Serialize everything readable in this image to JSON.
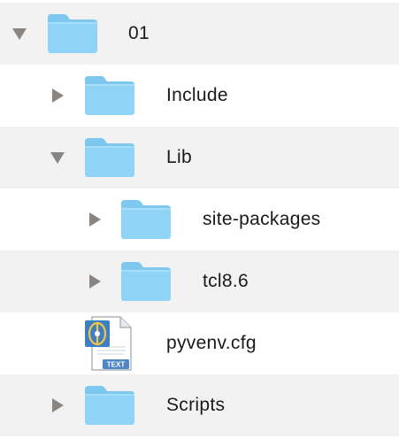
{
  "finder_tree": {
    "items": [
      {
        "label": "01",
        "type": "folder",
        "state": "expanded",
        "level": 0
      },
      {
        "label": "Include",
        "type": "folder",
        "state": "collapsed",
        "level": 1
      },
      {
        "label": "Lib",
        "type": "folder",
        "state": "expanded",
        "level": 1
      },
      {
        "label": "site-packages",
        "type": "folder",
        "state": "collapsed",
        "level": 2
      },
      {
        "label": "tcl8.6",
        "type": "folder",
        "state": "collapsed",
        "level": 2
      },
      {
        "label": "pyvenv.cfg",
        "type": "file",
        "level": 1,
        "badge": "TEXT"
      },
      {
        "label": "Scripts",
        "type": "folder",
        "state": "collapsed",
        "level": 1
      }
    ]
  },
  "colors": {
    "folder_body": "#8fd4f7",
    "folder_tab": "#7ec8ef",
    "disclosure_triangle": "#8a8580",
    "row_alt_background": "#f2f2f2",
    "text": "#1a1a1a"
  },
  "icons": {
    "expanded": "disclosure-expanded-icon",
    "collapsed": "disclosure-collapsed-icon",
    "folder": "folder-icon",
    "text_file": "text-document-icon"
  }
}
